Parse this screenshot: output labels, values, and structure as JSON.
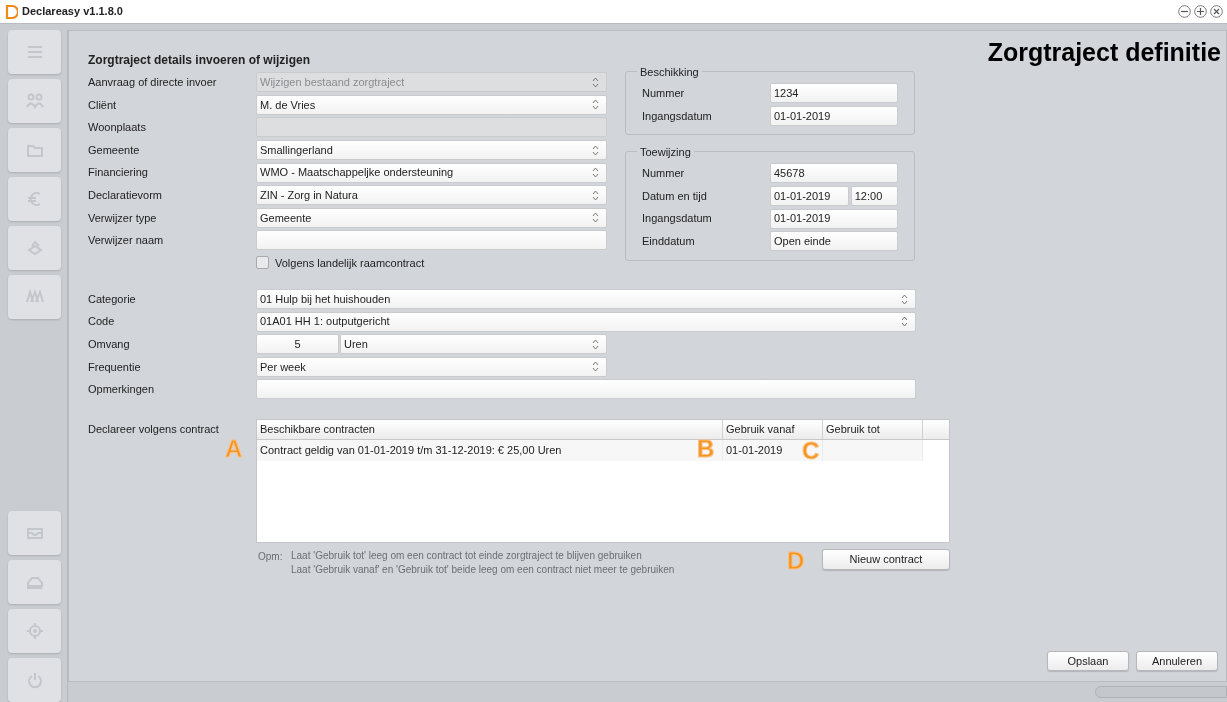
{
  "window": {
    "title": "Declareasy v1.1.8.0"
  },
  "page_title": "Zorgtraject definitie",
  "form": {
    "title": "Zorgtraject details invoeren of wijzigen",
    "fields": [
      {
        "label": "Aanvraag of directe invoer",
        "value": "Wijzigen bestaand zorgtraject",
        "kind": "select",
        "disabled": true
      },
      {
        "label": "Cliënt",
        "value": "M. de Vries",
        "kind": "select",
        "disabled": false
      },
      {
        "label": "Woonplaats",
        "kind": "input",
        "disabled": true
      },
      {
        "label": "Gemeente",
        "value": "Smallingerland",
        "kind": "select",
        "disabled": false
      },
      {
        "label": "Financiering",
        "value": "WMO - Maatschappeljke ondersteuning",
        "kind": "select",
        "disabled": false
      },
      {
        "label": "Declaratievorm",
        "value": "ZIN - Zorg in Natura",
        "kind": "select",
        "disabled": false
      },
      {
        "label": "Verwijzer type",
        "value": "Gemeente",
        "kind": "select",
        "disabled": false
      },
      {
        "label": "Verwijzer naam",
        "kind": "input",
        "disabled": false
      }
    ],
    "checkbox": {
      "label": "Volgens landelijk raamcontract",
      "checked": false
    },
    "details": [
      {
        "label": "Categorie",
        "value": "01 Hulp bij het huishouden",
        "kind": "select"
      },
      {
        "label": "Code",
        "value": "01A01 HH 1: outputgericht",
        "kind": "select"
      },
      {
        "label": "Omvang",
        "value": "5",
        "unit": "Uren",
        "kind": "amount"
      },
      {
        "label": "Frequentie",
        "value": "Per week",
        "kind": "short-select"
      },
      {
        "label": "Opmerkingen",
        "kind": "input"
      }
    ]
  },
  "groups": [
    {
      "title": "Beschikking",
      "fields": [
        {
          "label": "Nummer",
          "value": "1234"
        },
        {
          "label": "Ingangsdatum",
          "value": "01-01-2019"
        }
      ]
    },
    {
      "title": "Toewijzing",
      "fields": [
        {
          "label": "Nummer",
          "value": "45678"
        },
        {
          "label": "Datum en tijd",
          "value": "01-01-2019",
          "time": "12:00"
        },
        {
          "label": "Ingangsdatum",
          "value": "01-01-2019"
        },
        {
          "label": "Einddatum",
          "value": "Open einde"
        }
      ]
    }
  ],
  "contracts": {
    "label": "Declareer volgens contract",
    "columns": [
      "Beschikbare contracten",
      "Gebruik vanaf",
      "Gebruik tot"
    ],
    "rows": [
      {
        "cells": [
          "Contract geldig van 01-01-2019 t/m 31-12-2019: € 25,00 Uren",
          "01-01-2019"
        ]
      }
    ],
    "note_prefix": "Opm:",
    "notes": [
      "Laat 'Gebruik tot' leeg om een contract tot einde zorgtraject te blijven gebruiken",
      "Laat 'Gebruik vanaf' en 'Gebruik tot' beide leeg om een contract niet meer te gebruiken"
    ],
    "button": "Nieuw contract"
  },
  "callouts": [
    "A",
    "B",
    "C",
    "D"
  ],
  "buttons": [
    "Opslaan",
    "Annuleren"
  ]
}
